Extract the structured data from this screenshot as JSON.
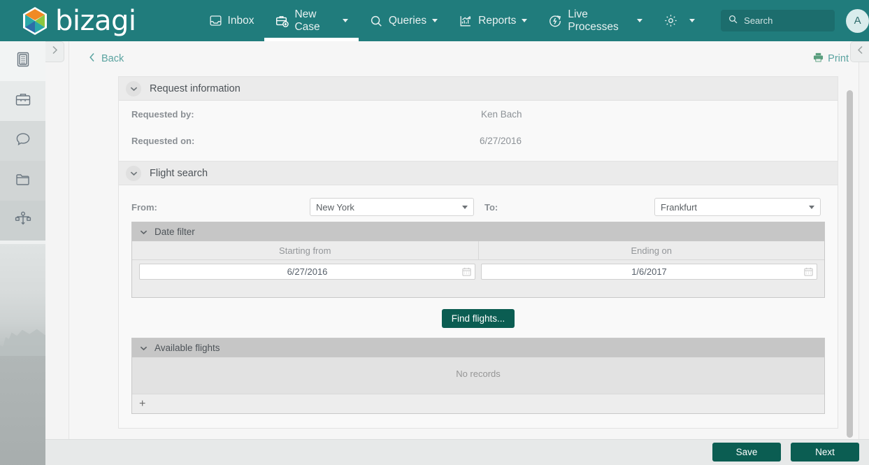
{
  "app": {
    "brand": "bizagi",
    "logo_colors": {
      "orange": "#f08a24",
      "green": "#8cc63f",
      "teal": "#2aa8a8",
      "blue": "#2d6ea8"
    },
    "accent": "#207c7c",
    "button_color": "#0b5d52"
  },
  "nav": {
    "items": [
      {
        "label": "Inbox",
        "icon": "inbox-icon",
        "caret": false,
        "active": false
      },
      {
        "label": "New Case",
        "icon": "new-case-icon",
        "caret": true,
        "active": true
      },
      {
        "label": "Queries",
        "icon": "search-icon",
        "caret": true,
        "active": false
      },
      {
        "label": "Reports",
        "icon": "reports-chart-icon",
        "caret": true,
        "active": false
      },
      {
        "label": "Live Processes",
        "icon": "live-processes-icon",
        "caret": true,
        "active": false
      }
    ],
    "settings": {
      "icon": "gear-icon",
      "caret": true
    },
    "search": {
      "placeholder": "Search",
      "value": "",
      "icon": "search-icon"
    },
    "avatar": {
      "initial": "A"
    }
  },
  "sidebar": {
    "expand_icon": "chevron-right-icon",
    "items": [
      {
        "icon": "clipboard-list-icon",
        "name": "sidebar-item-tasks"
      },
      {
        "icon": "briefcase-icon",
        "name": "sidebar-item-cases"
      },
      {
        "icon": "chat-bubble-icon",
        "name": "sidebar-item-messages"
      },
      {
        "icon": "folder-icon",
        "name": "sidebar-item-documents"
      },
      {
        "icon": "process-flow-icon",
        "name": "sidebar-item-process"
      }
    ]
  },
  "right_panel": {
    "collapse_icon": "chevron-left-icon"
  },
  "toolbar": {
    "back_label": "Back",
    "back_icon": "chevron-left-icon",
    "print_label": "Print",
    "print_icon": "printer-icon"
  },
  "sections": {
    "request_information": {
      "title": "Request information",
      "toggle_icon": "chevron-down-icon",
      "fields": [
        {
          "label": "Requested by:",
          "value": "Ken Bach"
        },
        {
          "label": "Requested on:",
          "value": "6/27/2016"
        }
      ]
    },
    "flight_search": {
      "title": "Flight search",
      "toggle_icon": "chevron-down-icon",
      "from": {
        "label": "From:",
        "value": "New York"
      },
      "to": {
        "label": "To:",
        "value": "Frankfurt"
      },
      "date_filter": {
        "title": "Date filter",
        "toggle_icon": "chevron-down-icon",
        "columns": [
          "Starting from",
          "Ending on"
        ],
        "values": [
          "6/27/2016",
          "1/6/2017"
        ],
        "calendar_icon": "calendar-icon"
      },
      "find_button": "Find flights..."
    },
    "available_flights": {
      "title": "Available flights",
      "toggle_icon": "chevron-down-icon",
      "empty_text": "No records",
      "add_label": "+"
    }
  },
  "footer": {
    "save_label": "Save",
    "next_label": "Next"
  }
}
